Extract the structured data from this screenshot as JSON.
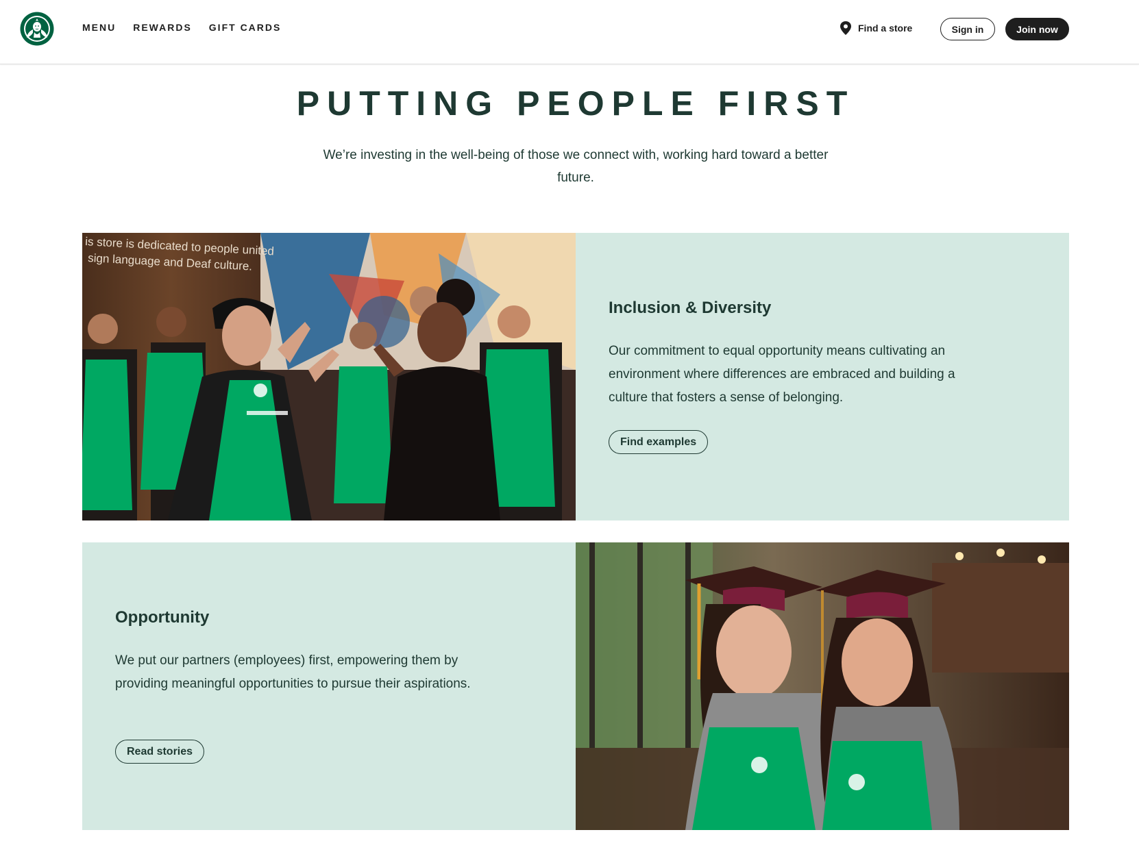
{
  "colors": {
    "brand_green": "#006241",
    "house_green": "#1e3932",
    "apron_green": "#00a862",
    "light_green_panel": "#d4e9e2",
    "black": "#1e1e1e"
  },
  "header": {
    "logo_icon": "starbucks-siren-logo",
    "nav": [
      {
        "label": "MENU"
      },
      {
        "label": "REWARDS"
      },
      {
        "label": "GIFT CARDS"
      }
    ],
    "find_store": {
      "icon": "location-pin-icon",
      "label": "Find a store"
    },
    "sign_in_label": "Sign in",
    "join_label": "Join now"
  },
  "hero": {
    "title": "PUTTING PEOPLE FIRST",
    "subtitle": "We’re investing in the well-being of those we connect with, working hard toward a better future."
  },
  "features": [
    {
      "title": "Inclusion & Diversity",
      "body": "Our commitment to equal opportunity means cultivating an environment where differences are embraced and building a culture that fosters a sense of belonging.",
      "button_label": "Find examples",
      "image_wall_text": "is store is dedicated to people united sign language and Deaf culture."
    },
    {
      "title": "Opportunity",
      "body": "We put our partners (employees) first, empowering them by providing meaningful opportunities to pursue their aspirations.",
      "button_label": "Read stories"
    }
  ]
}
